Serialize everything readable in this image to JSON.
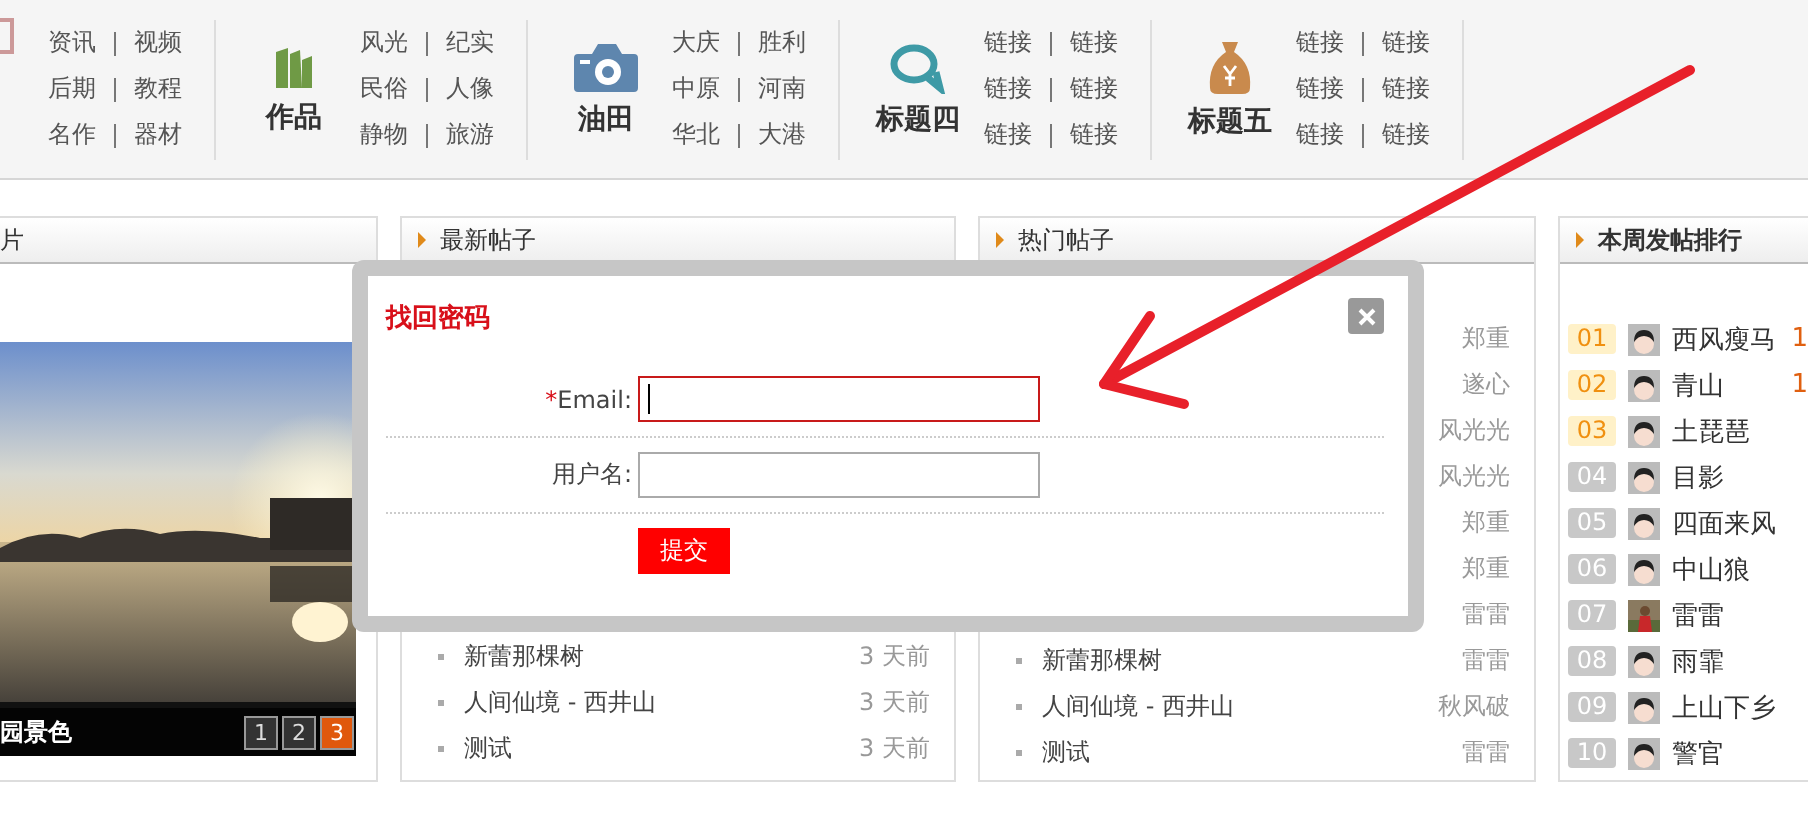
{
  "nav": {
    "groups": [
      {
        "links": [
          [
            "资讯",
            "视频"
          ],
          [
            "后期",
            "教程"
          ],
          [
            "名作",
            "器材"
          ]
        ]
      },
      {
        "title": "作品",
        "links": [
          [
            "风光",
            "纪实"
          ],
          [
            "民俗",
            "人像"
          ],
          [
            "静物",
            "旅游"
          ]
        ]
      },
      {
        "title": "油田",
        "links": [
          [
            "大庆",
            "胜利"
          ],
          [
            "中原",
            "河南"
          ],
          [
            "华北",
            "大港"
          ]
        ]
      },
      {
        "title": "标题四",
        "links": [
          [
            "链接",
            "链接"
          ],
          [
            "链接",
            "链接"
          ],
          [
            "链接",
            "链接"
          ]
        ]
      },
      {
        "title": "标题五",
        "links": [
          [
            "链接",
            "链接"
          ],
          [
            "链接",
            "链接"
          ],
          [
            "链接",
            "链接"
          ]
        ]
      }
    ]
  },
  "photo_panel": {
    "title": "片",
    "caption": "园景色",
    "pages": [
      {
        "label": "1",
        "selected": false
      },
      {
        "label": "2",
        "selected": false
      },
      {
        "label": "3",
        "selected": true
      }
    ]
  },
  "latest_panel": {
    "title": "最新帖子",
    "posts": [
      {
        "title": "新蕾那棵树",
        "time": "3 天前"
      },
      {
        "title": "人间仙境 - 西井山",
        "time": "3 天前"
      },
      {
        "title": "测试",
        "time": "3 天前"
      }
    ]
  },
  "hot_panel": {
    "title": "热门帖子",
    "posts": [
      {
        "author": "郑重"
      },
      {
        "author": "遂心"
      },
      {
        "author": "风光光"
      },
      {
        "author": "风光光"
      },
      {
        "author": "郑重"
      },
      {
        "author": "郑重"
      },
      {
        "author": "雷雷"
      },
      {
        "title": "新蕾那棵树",
        "author": "雷雷"
      },
      {
        "title": "人间仙境 - 西井山",
        "author": "秋风破"
      },
      {
        "title": "测试",
        "author": "雷雷"
      }
    ]
  },
  "ranking_panel": {
    "title": "本周发帖排行",
    "entries": [
      {
        "rank": "01",
        "top": true,
        "kind": "default",
        "name": "西风瘦马",
        "count": "1"
      },
      {
        "rank": "02",
        "top": true,
        "kind": "default",
        "name": "青山",
        "count": "1"
      },
      {
        "rank": "03",
        "top": true,
        "kind": "default",
        "name": "土琵琶"
      },
      {
        "rank": "04",
        "top": false,
        "kind": "default",
        "name": "目影"
      },
      {
        "rank": "05",
        "top": false,
        "kind": "default",
        "name": "四面来风"
      },
      {
        "rank": "06",
        "top": false,
        "kind": "default",
        "name": "中山狼"
      },
      {
        "rank": "07",
        "top": false,
        "name": "雷雷"
      },
      {
        "rank": "08",
        "top": false,
        "kind": "default",
        "name": "雨霏"
      },
      {
        "rank": "09",
        "top": false,
        "kind": "default",
        "name": "上山下乡"
      },
      {
        "rank": "10",
        "top": false,
        "kind": "default",
        "name": "警官"
      }
    ]
  },
  "dialog": {
    "title": "找回密码",
    "fields": [
      {
        "marker": "*",
        "label": "Email:",
        "focused": true
      },
      {
        "label": "用户名:",
        "focused": false
      }
    ],
    "submit": "提交"
  }
}
